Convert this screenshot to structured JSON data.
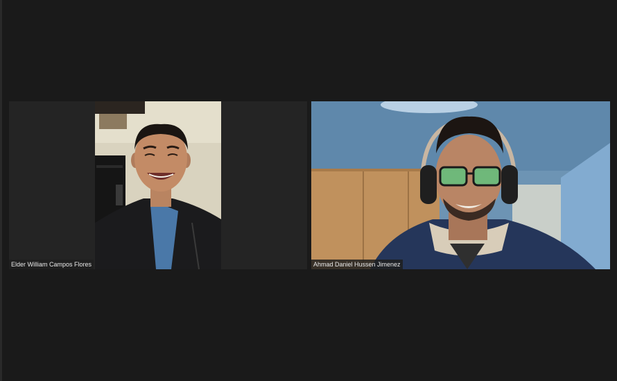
{
  "meeting": {
    "participants": [
      {
        "name": "Elder William Campos Flores",
        "video": "participant-video-smiling-young-man-dark-hoodie"
      },
      {
        "name": "Ahmad Daniel Hussen Jimenez",
        "video": "participant-video-young-man-glasses-headphones"
      }
    ]
  },
  "colors": {
    "background": "#1a1a1a",
    "tile": "#242424",
    "name_tag_bg": "#1e1e1e",
    "name_tag_text": "#e8e8e8"
  }
}
